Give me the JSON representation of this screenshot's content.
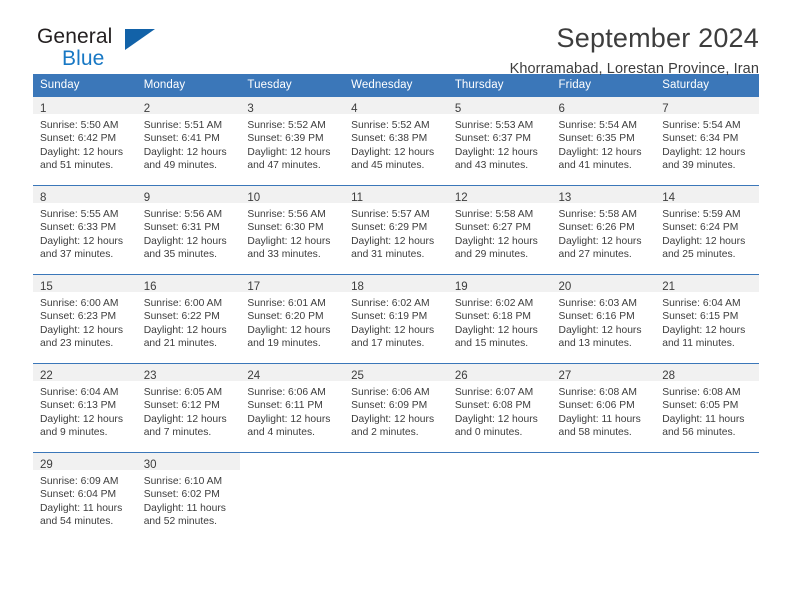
{
  "brand": {
    "name_part1": "General",
    "name_part2": "Blue",
    "triangle_icon": "triangle-icon",
    "colors": {
      "dark": "#231f20",
      "blue": "#1878c4",
      "triangle": "#1262a8"
    }
  },
  "header": {
    "title": "September 2024",
    "subtitle": "Khorramabad, Lorestan Province, Iran"
  },
  "theme": {
    "header_blue": "#3b77b9",
    "daynum_band": "#f1f1f1",
    "text": "#3d3d3d"
  },
  "weekday_headers": [
    "Sunday",
    "Monday",
    "Tuesday",
    "Wednesday",
    "Thursday",
    "Friday",
    "Saturday"
  ],
  "weeks": [
    [
      {
        "day": "1",
        "sunrise": "Sunrise: 5:50 AM",
        "sunset": "Sunset: 6:42 PM",
        "daylight1": "Daylight: 12 hours",
        "daylight2": "and 51 minutes."
      },
      {
        "day": "2",
        "sunrise": "Sunrise: 5:51 AM",
        "sunset": "Sunset: 6:41 PM",
        "daylight1": "Daylight: 12 hours",
        "daylight2": "and 49 minutes."
      },
      {
        "day": "3",
        "sunrise": "Sunrise: 5:52 AM",
        "sunset": "Sunset: 6:39 PM",
        "daylight1": "Daylight: 12 hours",
        "daylight2": "and 47 minutes."
      },
      {
        "day": "4",
        "sunrise": "Sunrise: 5:52 AM",
        "sunset": "Sunset: 6:38 PM",
        "daylight1": "Daylight: 12 hours",
        "daylight2": "and 45 minutes."
      },
      {
        "day": "5",
        "sunrise": "Sunrise: 5:53 AM",
        "sunset": "Sunset: 6:37 PM",
        "daylight1": "Daylight: 12 hours",
        "daylight2": "and 43 minutes."
      },
      {
        "day": "6",
        "sunrise": "Sunrise: 5:54 AM",
        "sunset": "Sunset: 6:35 PM",
        "daylight1": "Daylight: 12 hours",
        "daylight2": "and 41 minutes."
      },
      {
        "day": "7",
        "sunrise": "Sunrise: 5:54 AM",
        "sunset": "Sunset: 6:34 PM",
        "daylight1": "Daylight: 12 hours",
        "daylight2": "and 39 minutes."
      }
    ],
    [
      {
        "day": "8",
        "sunrise": "Sunrise: 5:55 AM",
        "sunset": "Sunset: 6:33 PM",
        "daylight1": "Daylight: 12 hours",
        "daylight2": "and 37 minutes."
      },
      {
        "day": "9",
        "sunrise": "Sunrise: 5:56 AM",
        "sunset": "Sunset: 6:31 PM",
        "daylight1": "Daylight: 12 hours",
        "daylight2": "and 35 minutes."
      },
      {
        "day": "10",
        "sunrise": "Sunrise: 5:56 AM",
        "sunset": "Sunset: 6:30 PM",
        "daylight1": "Daylight: 12 hours",
        "daylight2": "and 33 minutes."
      },
      {
        "day": "11",
        "sunrise": "Sunrise: 5:57 AM",
        "sunset": "Sunset: 6:29 PM",
        "daylight1": "Daylight: 12 hours",
        "daylight2": "and 31 minutes."
      },
      {
        "day": "12",
        "sunrise": "Sunrise: 5:58 AM",
        "sunset": "Sunset: 6:27 PM",
        "daylight1": "Daylight: 12 hours",
        "daylight2": "and 29 minutes."
      },
      {
        "day": "13",
        "sunrise": "Sunrise: 5:58 AM",
        "sunset": "Sunset: 6:26 PM",
        "daylight1": "Daylight: 12 hours",
        "daylight2": "and 27 minutes."
      },
      {
        "day": "14",
        "sunrise": "Sunrise: 5:59 AM",
        "sunset": "Sunset: 6:24 PM",
        "daylight1": "Daylight: 12 hours",
        "daylight2": "and 25 minutes."
      }
    ],
    [
      {
        "day": "15",
        "sunrise": "Sunrise: 6:00 AM",
        "sunset": "Sunset: 6:23 PM",
        "daylight1": "Daylight: 12 hours",
        "daylight2": "and 23 minutes."
      },
      {
        "day": "16",
        "sunrise": "Sunrise: 6:00 AM",
        "sunset": "Sunset: 6:22 PM",
        "daylight1": "Daylight: 12 hours",
        "daylight2": "and 21 minutes."
      },
      {
        "day": "17",
        "sunrise": "Sunrise: 6:01 AM",
        "sunset": "Sunset: 6:20 PM",
        "daylight1": "Daylight: 12 hours",
        "daylight2": "and 19 minutes."
      },
      {
        "day": "18",
        "sunrise": "Sunrise: 6:02 AM",
        "sunset": "Sunset: 6:19 PM",
        "daylight1": "Daylight: 12 hours",
        "daylight2": "and 17 minutes."
      },
      {
        "day": "19",
        "sunrise": "Sunrise: 6:02 AM",
        "sunset": "Sunset: 6:18 PM",
        "daylight1": "Daylight: 12 hours",
        "daylight2": "and 15 minutes."
      },
      {
        "day": "20",
        "sunrise": "Sunrise: 6:03 AM",
        "sunset": "Sunset: 6:16 PM",
        "daylight1": "Daylight: 12 hours",
        "daylight2": "and 13 minutes."
      },
      {
        "day": "21",
        "sunrise": "Sunrise: 6:04 AM",
        "sunset": "Sunset: 6:15 PM",
        "daylight1": "Daylight: 12 hours",
        "daylight2": "and 11 minutes."
      }
    ],
    [
      {
        "day": "22",
        "sunrise": "Sunrise: 6:04 AM",
        "sunset": "Sunset: 6:13 PM",
        "daylight1": "Daylight: 12 hours",
        "daylight2": "and 9 minutes."
      },
      {
        "day": "23",
        "sunrise": "Sunrise: 6:05 AM",
        "sunset": "Sunset: 6:12 PM",
        "daylight1": "Daylight: 12 hours",
        "daylight2": "and 7 minutes."
      },
      {
        "day": "24",
        "sunrise": "Sunrise: 6:06 AM",
        "sunset": "Sunset: 6:11 PM",
        "daylight1": "Daylight: 12 hours",
        "daylight2": "and 4 minutes."
      },
      {
        "day": "25",
        "sunrise": "Sunrise: 6:06 AM",
        "sunset": "Sunset: 6:09 PM",
        "daylight1": "Daylight: 12 hours",
        "daylight2": "and 2 minutes."
      },
      {
        "day": "26",
        "sunrise": "Sunrise: 6:07 AM",
        "sunset": "Sunset: 6:08 PM",
        "daylight1": "Daylight: 12 hours",
        "daylight2": "and 0 minutes."
      },
      {
        "day": "27",
        "sunrise": "Sunrise: 6:08 AM",
        "sunset": "Sunset: 6:06 PM",
        "daylight1": "Daylight: 11 hours",
        "daylight2": "and 58 minutes."
      },
      {
        "day": "28",
        "sunrise": "Sunrise: 6:08 AM",
        "sunset": "Sunset: 6:05 PM",
        "daylight1": "Daylight: 11 hours",
        "daylight2": "and 56 minutes."
      }
    ],
    [
      {
        "day": "29",
        "sunrise": "Sunrise: 6:09 AM",
        "sunset": "Sunset: 6:04 PM",
        "daylight1": "Daylight: 11 hours",
        "daylight2": "and 54 minutes."
      },
      {
        "day": "30",
        "sunrise": "Sunrise: 6:10 AM",
        "sunset": "Sunset: 6:02 PM",
        "daylight1": "Daylight: 11 hours",
        "daylight2": "and 52 minutes."
      },
      {
        "day": "",
        "sunrise": "",
        "sunset": "",
        "daylight1": "",
        "daylight2": ""
      },
      {
        "day": "",
        "sunrise": "",
        "sunset": "",
        "daylight1": "",
        "daylight2": ""
      },
      {
        "day": "",
        "sunrise": "",
        "sunset": "",
        "daylight1": "",
        "daylight2": ""
      },
      {
        "day": "",
        "sunrise": "",
        "sunset": "",
        "daylight1": "",
        "daylight2": ""
      },
      {
        "day": "",
        "sunrise": "",
        "sunset": "",
        "daylight1": "",
        "daylight2": ""
      }
    ]
  ]
}
